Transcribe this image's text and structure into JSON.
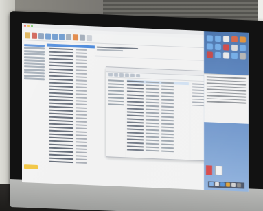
{
  "scene": {
    "subject": "computer-monitor-photo"
  },
  "outlook": {
    "ribbon_tabs": [
      "",
      "",
      "",
      "",
      "",
      "",
      ""
    ]
  },
  "colors": {
    "selection_blue": "#3b7fd9",
    "folder_highlight": "#f2c233",
    "desktop_blue": "#5b86c2"
  },
  "icons": {
    "app_icons": [
      "folder-icon",
      "folder-icon",
      "folder-icon",
      "app-icon",
      "app-icon",
      "folder-icon",
      "folder-icon",
      "app-icon",
      "app-icon",
      "folder-icon",
      "app-icon",
      "folder-icon",
      "app-icon",
      "folder-icon",
      "app-icon"
    ]
  }
}
